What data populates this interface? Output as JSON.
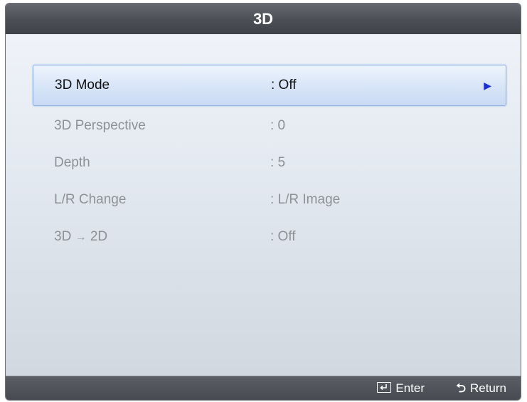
{
  "window": {
    "title": "3D"
  },
  "menu": {
    "items": [
      {
        "label": "3D Mode",
        "value": ": Off",
        "selected": true
      },
      {
        "label": "3D Perspective",
        "value": ": 0"
      },
      {
        "label": "Depth",
        "value": ": 5"
      },
      {
        "label": "L/R Change",
        "value": ": L/R Image"
      },
      {
        "label_a": "3D",
        "label_arrow": "→",
        "label_b": "2D",
        "value": ": Off"
      }
    ]
  },
  "footer": {
    "enter_label": "Enter",
    "return_label": "Return"
  },
  "colors": {
    "highlight": "#c9daf4",
    "arrow": "#1f2fd6"
  }
}
